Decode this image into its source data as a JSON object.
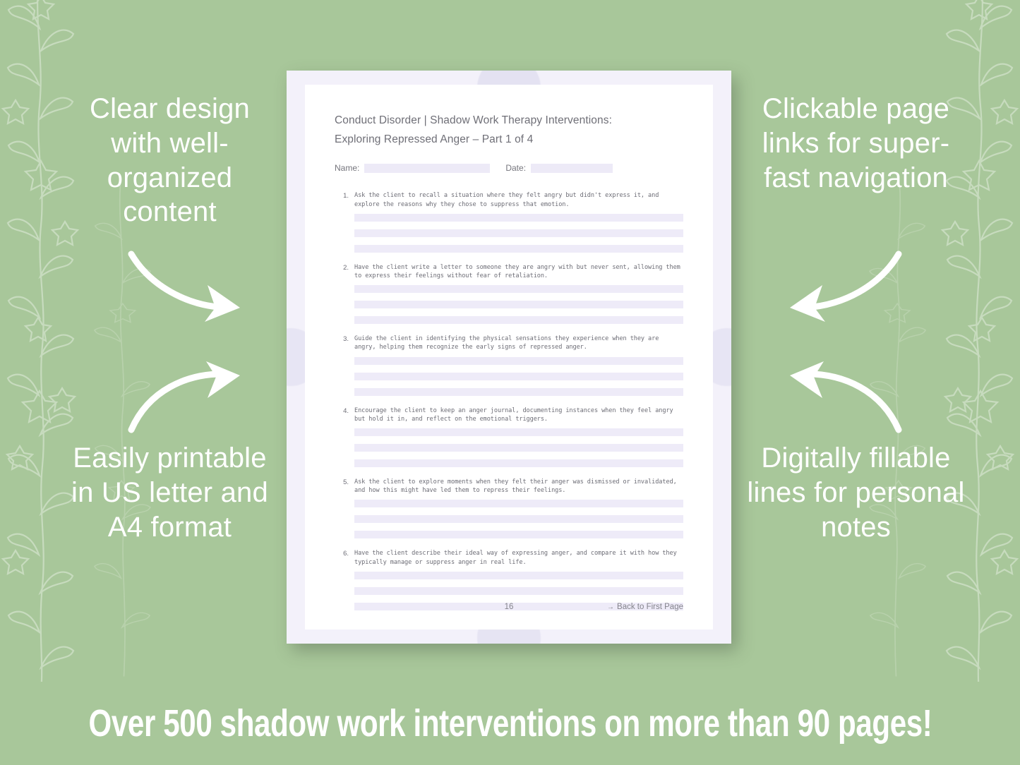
{
  "theme": {
    "background_green": "#a8c79a",
    "page_frame_lavender": "#f3f1fa",
    "page_white": "#ffffff",
    "fill_line_lavender": "#eeebf8",
    "text_gray": "#6d6d76",
    "caption_white": "#ffffff"
  },
  "captions": {
    "top_left": "Clear design with well-organized content",
    "bottom_left": "Easily printable in US letter and A4 format",
    "top_right": "Clickable page links for super-fast navigation",
    "bottom_right": "Digitally fillable lines for personal notes"
  },
  "banner": {
    "text": "Over 500 shadow work interventions on more than 90 pages!"
  },
  "worksheet": {
    "title_line1": "Conduct Disorder | Shadow Work Therapy Interventions:",
    "title_line2": "Exploring Repressed Anger   – Part 1 of 4",
    "name_label": "Name:",
    "date_label": "Date:",
    "name_value": "",
    "date_value": "",
    "items": [
      {
        "number": "1.",
        "text": "Ask the client to recall a situation where they felt angry but didn't express it, and explore the reasons why they chose to suppress that emotion.",
        "lines": 3
      },
      {
        "number": "2.",
        "text": "Have the client write a letter to someone they are angry with but never sent, allowing them to express their feelings without fear of retaliation.",
        "lines": 3
      },
      {
        "number": "3.",
        "text": "Guide the client in identifying the physical sensations they experience when they are angry, helping them recognize the early signs of repressed anger.",
        "lines": 3
      },
      {
        "number": "4.",
        "text": "Encourage the client to keep an anger journal, documenting instances when they feel angry but hold it in, and reflect on the emotional triggers.",
        "lines": 3
      },
      {
        "number": "5.",
        "text": "Ask the client to explore moments when they felt their anger was dismissed or invalidated, and how this might have led them to repress their feelings.",
        "lines": 3
      },
      {
        "number": "6.",
        "text": "Have the client describe their ideal way of expressing anger, and compare it with how they typically manage or suppress anger in real life.",
        "lines": 3
      }
    ],
    "footer": {
      "page_number": "16",
      "back_link_arrow": "→",
      "back_link_label": "Back to First Page"
    }
  }
}
